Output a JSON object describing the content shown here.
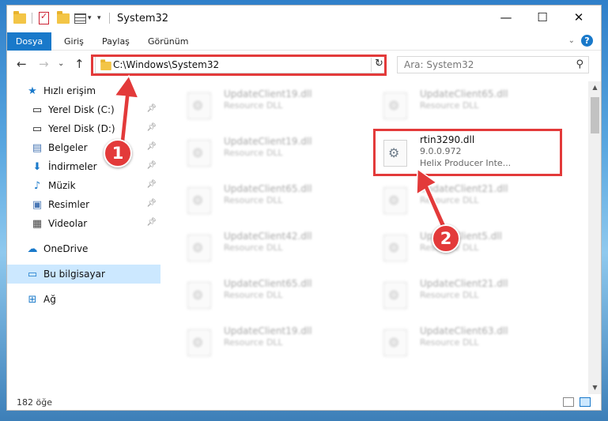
{
  "window": {
    "title": "System32"
  },
  "ribbon": {
    "tabs": [
      "Dosya",
      "Giriş",
      "Paylaş",
      "Görünüm"
    ]
  },
  "nav": {
    "address": "C:\\Windows\\System32",
    "search_placeholder": "Ara: System32"
  },
  "sidebar": {
    "quick_access": "Hızlı erişim",
    "items": [
      {
        "label": "Yerel Disk (C:)",
        "icon": "drive-icon"
      },
      {
        "label": "Yerel Disk (D:)",
        "icon": "drive-icon"
      },
      {
        "label": "Belgeler",
        "icon": "documents-icon"
      },
      {
        "label": "İndirmeler",
        "icon": "downloads-icon"
      },
      {
        "label": "Müzik",
        "icon": "music-icon"
      },
      {
        "label": "Resimler",
        "icon": "pictures-icon"
      },
      {
        "label": "Videolar",
        "icon": "videos-icon"
      }
    ],
    "onedrive": "OneDrive",
    "this_pc": "Bu bilgisayar",
    "network": "Ağ"
  },
  "files": [
    {
      "name": "UpdateClient19.dll",
      "type": "Resource DLL"
    },
    {
      "name": "UpdateClient65.dll",
      "type": "Resource DLL"
    },
    {
      "name": "UpdateClient19.dll",
      "type": "Resource DLL"
    },
    {
      "name": "rtin3290.dll",
      "version": "9.0.0.972",
      "description": "Helix Producer Inte..."
    },
    {
      "name": "UpdateClient65.dll",
      "type": "Resource DLL"
    },
    {
      "name": "UpdateClient21.dll",
      "type": "Resource DLL"
    },
    {
      "name": "UpdateClient42.dll",
      "type": "Resource DLL"
    },
    {
      "name": "UpdateClient5.dll",
      "type": "Resource DLL"
    },
    {
      "name": "UpdateClient65.dll",
      "type": "Resource DLL"
    },
    {
      "name": "UpdateClient21.dll",
      "type": "Resource DLL"
    },
    {
      "name": "UpdateClient19.dll",
      "type": "Resource DLL"
    },
    {
      "name": "UpdateClient63.dll",
      "type": "Resource DLL"
    }
  ],
  "status": {
    "item_count": "182 öğe"
  },
  "annotations": {
    "step1": "1",
    "step2": "2"
  },
  "colors": {
    "accent": "#1979ca",
    "annotation": "#e33a3a",
    "selected": "#cce8ff"
  }
}
